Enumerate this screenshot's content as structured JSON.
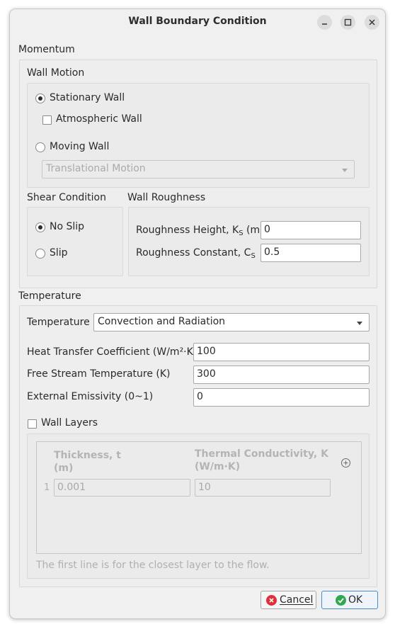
{
  "window": {
    "title": "Wall Boundary Condition"
  },
  "momentum": {
    "section_label": "Momentum",
    "wall_motion": {
      "label": "Wall Motion",
      "stationary_label": "Stationary Wall",
      "stationary_selected": true,
      "atmospheric_label": "Atmospheric Wall",
      "atmospheric_checked": false,
      "moving_label": "Moving Wall",
      "moving_selected": false,
      "motion_type": "Translational Motion"
    },
    "shear": {
      "label": "Shear Condition",
      "no_slip_label": "No Slip",
      "no_slip_selected": true,
      "slip_label": "Slip",
      "slip_selected": false
    },
    "roughness": {
      "label": "Wall Roughness",
      "height_label_main": "Roughness Height, K",
      "height_label_sub": "S",
      "height_label_unit": " (m)",
      "height_value": "0",
      "constant_label_main": "Roughness Constant, C",
      "constant_label_sub": "S",
      "constant_value": "0.5"
    }
  },
  "temperature": {
    "section_label": "Temperature",
    "type_label": "Temperature",
    "type_value": "Convection and Radiation",
    "htc_label": "Heat Transfer Coefficient (W/m²·K)",
    "htc_value": "100",
    "free_stream_label": "Free Stream Temperature (K)",
    "free_stream_value": "300",
    "emissivity_label": "External Emissivity (0~1)",
    "emissivity_value": "0",
    "wall_layers": {
      "label": "Wall Layers",
      "checked": false,
      "col_thickness": "Thickness, t",
      "col_thickness_unit": "(m)",
      "col_conductivity": "Thermal Conductivity, K",
      "col_conductivity_unit": "(W/m·K)",
      "rows": [
        {
          "index": "1",
          "thickness": "0.001",
          "conductivity": "10"
        }
      ],
      "note": "The first line is for the closest layer to the flow."
    }
  },
  "buttons": {
    "cancel_label": "Cancel",
    "ok_label": "OK"
  },
  "colors": {
    "cancel_icon": "#e0303a",
    "ok_icon": "#2fa84f",
    "ok_border": "#4a8cc7"
  },
  "icons": [
    "minimize-icon",
    "maximize-icon",
    "close-icon",
    "add-row-icon",
    "cancel-icon",
    "ok-icon"
  ]
}
